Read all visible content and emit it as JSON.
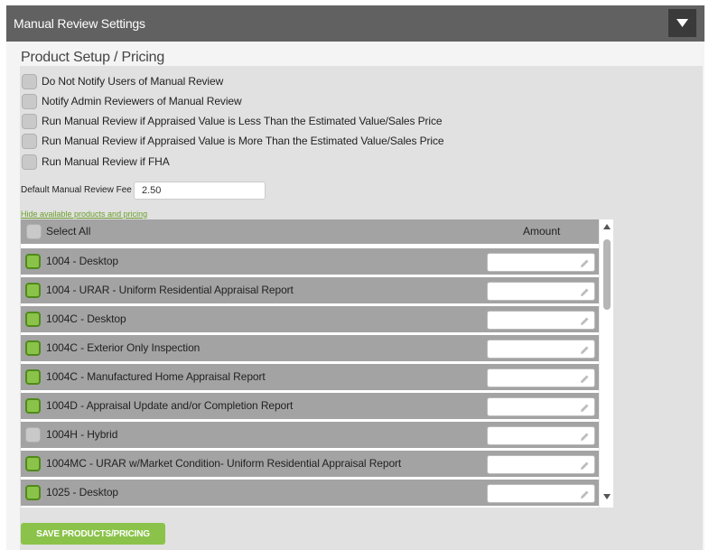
{
  "header": {
    "title": "Manual Review Settings",
    "toggle_icon": "caret-down-icon"
  },
  "section": {
    "title": "Product Setup / Pricing"
  },
  "options": [
    {
      "label": "Do Not Notify Users of Manual Review",
      "checked": false
    },
    {
      "label": "Notify Admin Reviewers of Manual Review",
      "checked": false
    },
    {
      "label": "Run Manual Review if Appraised Value is Less Than the Estimated Value/Sales Price",
      "checked": false
    },
    {
      "label": "Run Manual Review if Appraised Value is More Than the Estimated Value/Sales Price",
      "checked": false
    },
    {
      "label": "Run Manual Review if FHA",
      "checked": false
    }
  ],
  "fee": {
    "label": "Default Manual Review Fee",
    "value": "2.50"
  },
  "hide_link": "Hide available products and pricing",
  "list_header": {
    "select_all": "Select All",
    "amount": "Amount"
  },
  "products": [
    {
      "label": "1004 - Desktop",
      "checked": true,
      "amount": ""
    },
    {
      "label": "1004 - URAR - Uniform Residential Appraisal Report",
      "checked": true,
      "amount": ""
    },
    {
      "label": "1004C - Desktop",
      "checked": true,
      "amount": ""
    },
    {
      "label": "1004C - Exterior Only Inspection",
      "checked": true,
      "amount": ""
    },
    {
      "label": "1004C - Manufactured Home Appraisal Report",
      "checked": true,
      "amount": ""
    },
    {
      "label": "1004D - Appraisal Update and/or Completion Report",
      "checked": true,
      "amount": ""
    },
    {
      "label": "1004H - Hybrid",
      "checked": false,
      "amount": ""
    },
    {
      "label": "1004MC - URAR w/Market Condition- Uniform Residential Appraisal Report",
      "checked": true,
      "amount": ""
    },
    {
      "label": "1025 - Desktop",
      "checked": true,
      "amount": ""
    }
  ],
  "save_button": "SAVE PRODUCTS/PRICING",
  "colors": {
    "header_bg": "#616161",
    "accent_green": "#8bc34a",
    "row_bg": "#a3a3a3",
    "panel_bg": "#e1e1e1"
  }
}
